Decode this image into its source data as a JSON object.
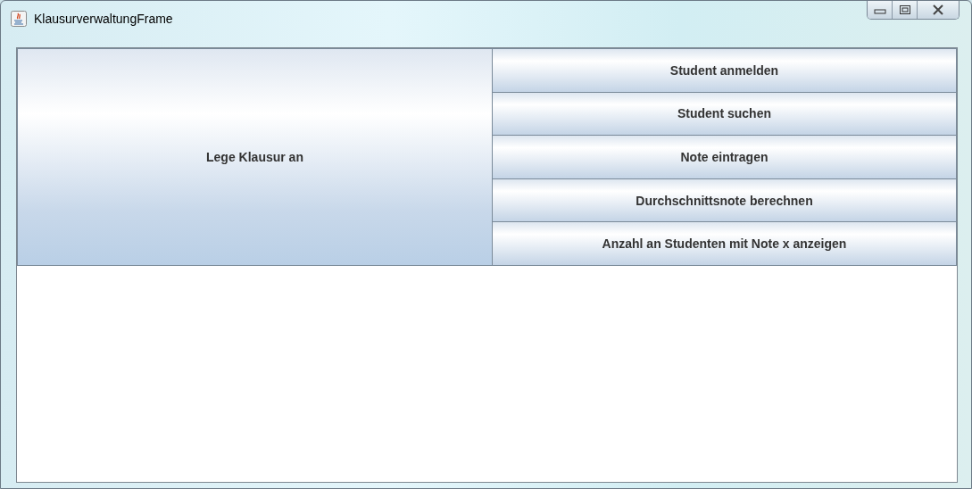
{
  "window": {
    "title": "KlausurverwaltungFrame"
  },
  "main_button": {
    "label": "Lege Klausur an"
  },
  "buttons": [
    {
      "label": "Student anmelden"
    },
    {
      "label": "Student suchen"
    },
    {
      "label": "Note eintragen"
    },
    {
      "label": "Durchschnittsnote berechnen"
    },
    {
      "label": "Anzahl an Studenten mit Note x anzeigen"
    }
  ]
}
